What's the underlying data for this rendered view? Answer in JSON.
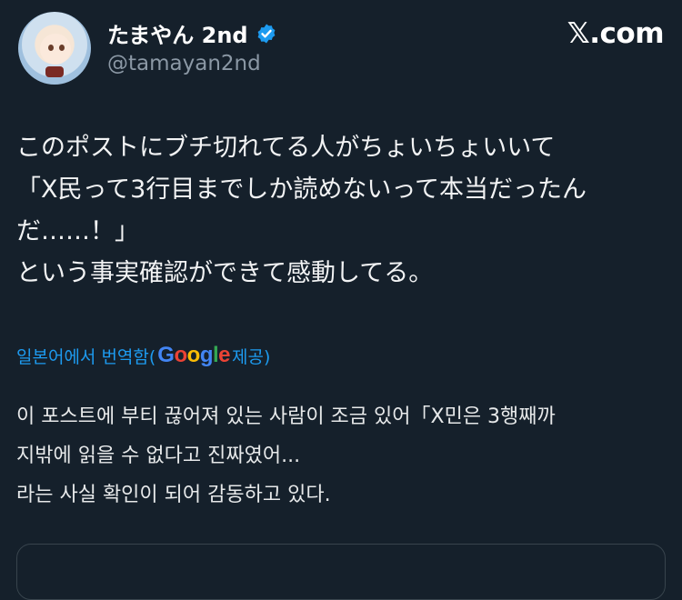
{
  "header": {
    "display_name": "たまやん 2nd",
    "handle": "@tamayan2nd",
    "verified_icon": "verified-badge-icon",
    "site_label": "𝕏.com"
  },
  "post": {
    "original_text": "このポストにブチ切れてる人がちょいちょいいて\n「X民って3行目までしか読めないって本当だったん\nだ……！」\nという事実確認ができて感動してる。",
    "translation_prefix": "일본어에서 번역함(",
    "translation_provider": "Google",
    "translation_suffix": " 제공)",
    "translated_text": "이 포스트에 부티 끊어져 있는 사람이 조금 있어「X민은 3행째까\n지밖에 읽을 수 없다고 진짜였어...\n라는 사실 확인이 되어 감동하고 있다."
  },
  "colors": {
    "background": "#15202b",
    "link": "#1d9bf0",
    "verified": "#1d9bf0",
    "secondary_text": "#8b98a5",
    "google_blue": "#4285f4",
    "google_red": "#ea4335",
    "google_yellow": "#fbbc05",
    "google_green": "#34a853"
  }
}
